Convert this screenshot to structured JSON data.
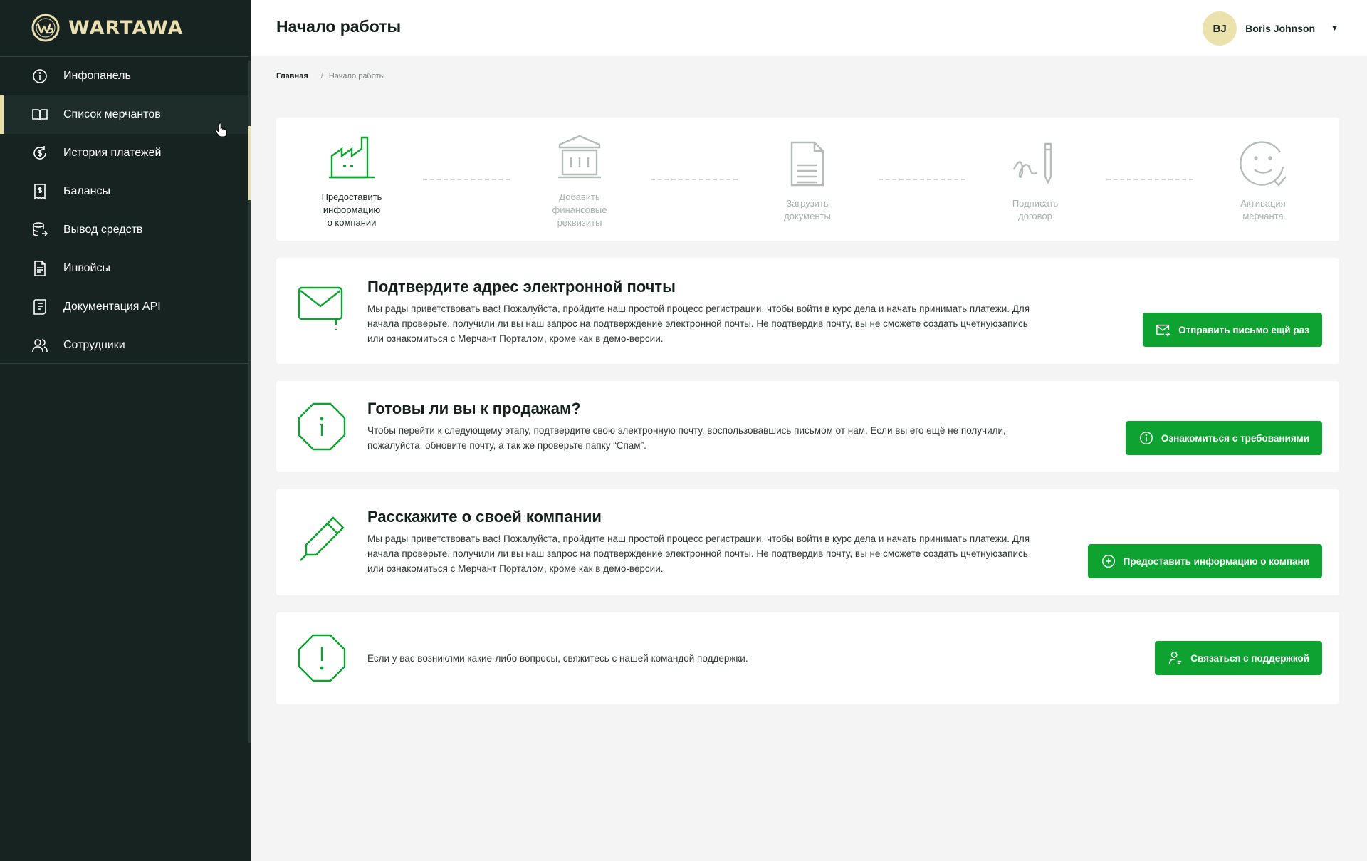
{
  "app": {
    "name": "WARTAWA"
  },
  "header": {
    "title": "Начало работы"
  },
  "user": {
    "initials": "BJ",
    "name": "Boris Johnson"
  },
  "sidebar": {
    "items": [
      {
        "label": "Инфопанель",
        "icon": "info-circle-icon"
      },
      {
        "label": "Список мерчантов",
        "icon": "book-open-icon",
        "active": true
      },
      {
        "label": "История платежей",
        "icon": "payment-history-icon"
      },
      {
        "label": "Балансы",
        "icon": "balance-receipt-icon"
      },
      {
        "label": "Вывод средств",
        "icon": "withdraw-database-icon"
      },
      {
        "label": "Инвойсы",
        "icon": "invoice-document-icon"
      },
      {
        "label": "Документация API",
        "icon": "api-docs-icon"
      },
      {
        "label": "Сотрудники",
        "icon": "employees-icon"
      }
    ]
  },
  "breadcrumb": {
    "home": "Главная",
    "separator": "/",
    "current": "Начало работы"
  },
  "steps": [
    {
      "label": [
        "Предоставить",
        "информацию",
        "о компании"
      ],
      "icon": "factory-icon",
      "state": "active"
    },
    {
      "label": [
        "Добавить",
        "финансовые",
        "реквизиты"
      ],
      "icon": "bank-icon",
      "state": "pending"
    },
    {
      "label": [
        "Загрузить",
        "документы"
      ],
      "icon": "document-icon",
      "state": "pending"
    },
    {
      "label": [
        "Подписать",
        "договор"
      ],
      "icon": "signature-icon",
      "state": "pending"
    },
    {
      "label": [
        "Активация",
        "мерчанта"
      ],
      "icon": "smile-check-icon",
      "state": "pending"
    }
  ],
  "cards": {
    "email": {
      "title": "Подтвердите адрес электронной почты",
      "text": "Мы рады приветствовать вас! Пожалуйста, пройдите наш простой процесс регистрации, чтобы войти в курс дела и начать принимать платежи. Для начала проверьте, получили ли вы наш запрос на подтверждение электронной почты. Не подтвердив почту, вы не сможете создать цчетнуюзапись или ознакомиться с Мерчант Порталом, кроме как в демо-версии.",
      "button": "Отправить письмо ещй раз"
    },
    "sales": {
      "title": "Готовы ли вы к продажам?",
      "text": "Чтобы перейти к следующему этапу, подтвердите свою электронную почту, воспользовавшись письмом от нам. Если вы его ещё не получили, пожалуйста, обновите почту, а так же проверьте папку “Спам”.",
      "button": "Ознакомиться с требованиями"
    },
    "company": {
      "title": "Расскажите о своей компании",
      "text": "Мы рады приветствовать вас! Пожалуйста, пройдите наш простой процесс регистрации, чтобы войти в курс дела и начать принимать платежи. Для начала проверьте, получили ли вы наш запрос на подтверждение электронной почты. Не подтвердив почту, вы не сможете создать цчетнуюзапись или ознакомиться с Мерчант Порталом, кроме как в демо-версии.",
      "button": "Предоставить информацию о компани"
    },
    "support": {
      "text": "Если у вас возниклми какие-либо вопросы, свяжитесь с нашей командой поддержки.",
      "button": "Связаться с поддержкой"
    }
  },
  "colors": {
    "sidebar_bg": "#172320",
    "accent_gold": "#e9e0a8",
    "primary_green": "#0ea231",
    "muted_step": "#a9b3ae"
  }
}
